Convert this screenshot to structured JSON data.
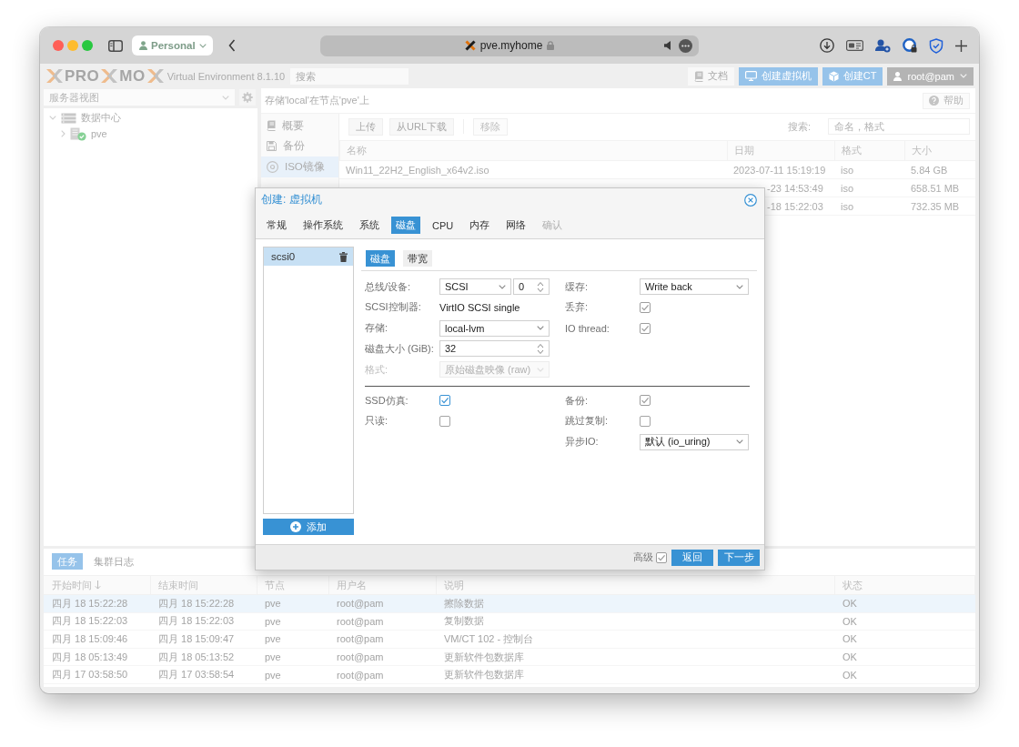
{
  "browser": {
    "profile": "Personal",
    "url": "pve.myhome"
  },
  "header": {
    "logo_parts": [
      "PRO",
      "MO"
    ],
    "product": "Virtual Environment 8.1.10",
    "search": {
      "placeholder": "搜索"
    },
    "buttons": [
      {
        "label": "文档",
        "kind": "docs"
      },
      {
        "label": "创建虚拟机",
        "kind": "vm"
      },
      {
        "label": "创建CT",
        "kind": "ct"
      }
    ],
    "user": "root@pam"
  },
  "sidebar": {
    "view": "服务器视图",
    "tree": [
      {
        "label": "数据中心",
        "kind": "datacenter",
        "expanded": true,
        "children": [
          {
            "label": "pve",
            "kind": "node",
            "expanded": false
          }
        ]
      }
    ]
  },
  "storage": {
    "title": "存储'local'在节点'pve'上",
    "help": "帮助",
    "nav": [
      {
        "label": "概要",
        "kind": "summary",
        "selected": false
      },
      {
        "label": "备份",
        "kind": "backup",
        "selected": false
      },
      {
        "label": "ISO镜像",
        "kind": "iso",
        "selected": true
      }
    ],
    "toolbar": [
      {
        "label": "上传",
        "disabled": false
      },
      {
        "label": "从URL下载",
        "disabled": false
      },
      {
        "label": "移除",
        "disabled": true
      }
    ],
    "search_label": "搜索:",
    "search": {
      "placeholder": "命名，格式"
    },
    "columns": [
      "名称",
      "日期",
      "格式",
      "大小"
    ],
    "rows": [
      {
        "name": "Win11_22H2_English_x64v2.iso",
        "date": "2023-07-11 15:19:19",
        "format": "iso",
        "size": "5.84 GB"
      },
      {
        "date": "-23 14:53:49",
        "format": "iso",
        "size": "658.51 MB"
      },
      {
        "date": "-18 15:22:03",
        "format": "iso",
        "size": "732.35 MB"
      }
    ]
  },
  "tasks": {
    "tabs": [
      {
        "label": "任务",
        "selected": true
      },
      {
        "label": "集群日志",
        "selected": false
      }
    ],
    "columns": [
      {
        "label": "开始时间",
        "sorted": true
      },
      {
        "label": "结束时间",
        "sorted": false
      },
      {
        "label": "节点",
        "sorted": false
      },
      {
        "label": "用户名",
        "sorted": false
      },
      {
        "label": "说明",
        "sorted": false
      },
      {
        "label": "状态",
        "sorted": false
      }
    ],
    "rows": [
      {
        "start": "四月 18 15:22:28",
        "end": "四月 18 15:22:28",
        "node": "pve",
        "user": "root@pam",
        "description": "擦除数据",
        "status": "OK",
        "selected": true
      },
      {
        "start": "四月 18 15:22:03",
        "end": "四月 18 15:22:03",
        "node": "pve",
        "user": "root@pam",
        "description": "复制数据",
        "status": "OK",
        "selected": false
      },
      {
        "start": "四月 18 15:09:46",
        "end": "四月 18 15:09:47",
        "node": "pve",
        "user": "root@pam",
        "description": "VM/CT 102 - 控制台",
        "status": "OK",
        "selected": false
      },
      {
        "start": "四月 18 05:13:49",
        "end": "四月 18 05:13:52",
        "node": "pve",
        "user": "root@pam",
        "description": "更新软件包数据库",
        "status": "OK",
        "selected": false
      },
      {
        "start": "四月 17 03:58:50",
        "end": "四月 17 03:58:54",
        "node": "pve",
        "user": "root@pam",
        "description": "更新软件包数据库",
        "status": "OK",
        "selected": false
      }
    ]
  },
  "dialog": {
    "title": "创建: 虚拟机",
    "tabs": [
      {
        "label": "常规",
        "selected": false,
        "disabled": false
      },
      {
        "label": "操作系统",
        "selected": false,
        "disabled": false
      },
      {
        "label": "系统",
        "selected": false,
        "disabled": false
      },
      {
        "label": "磁盘",
        "selected": true,
        "disabled": false
      },
      {
        "label": "CPU",
        "selected": false,
        "disabled": false
      },
      {
        "label": "内存",
        "selected": false,
        "disabled": false
      },
      {
        "label": "网络",
        "selected": false,
        "disabled": false
      },
      {
        "label": "确认",
        "selected": false,
        "disabled": true
      }
    ],
    "disks": [
      {
        "label": "scsi0",
        "selected": true
      }
    ],
    "add_button": "添加",
    "subtabs": [
      {
        "label": "磁盘",
        "selected": true
      },
      {
        "label": "带宽",
        "selected": false
      }
    ],
    "fields": {
      "left": [
        {
          "label": "总线/设备:",
          "kind": "combo_spin",
          "value": "SCSI",
          "number": "0",
          "disabled": false
        },
        {
          "label": "SCSI控制器:",
          "kind": "text",
          "value": "VirtIO SCSI single",
          "disabled": false
        },
        {
          "label": "存储:",
          "kind": "combo",
          "value": "local-lvm",
          "disabled": false
        },
        {
          "label": "磁盘大小 (GiB):",
          "kind": "spinner",
          "value": "32",
          "disabled": false
        },
        {
          "label": "格式:",
          "kind": "combo",
          "value": "原始磁盘映像 (raw)",
          "disabled": true
        }
      ],
      "right": [
        {
          "label": "缓存:",
          "kind": "combo",
          "value": "Write back",
          "disabled": false
        },
        {
          "label": "丢弃:",
          "kind": "checkbox",
          "checked": true,
          "focused": false,
          "disabled": false
        },
        {
          "label": "IO thread:",
          "kind": "checkbox",
          "checked": true,
          "focused": false,
          "disabled": false
        }
      ]
    },
    "advanced_fields": {
      "left": [
        {
          "label": "SSD仿真:",
          "kind": "checkbox",
          "checked": true,
          "focused": true,
          "disabled": false
        },
        {
          "label": "只读:",
          "kind": "checkbox",
          "checked": false,
          "focused": false,
          "disabled": false
        }
      ],
      "right": [
        {
          "label": "备份:",
          "kind": "checkbox",
          "checked": true,
          "focused": false,
          "disabled": false
        },
        {
          "label": "跳过复制:",
          "kind": "checkbox",
          "checked": false,
          "focused": false,
          "disabled": false
        },
        {
          "label": "异步IO:",
          "kind": "combo",
          "value": "默认 (io_uring)",
          "disabled": false
        }
      ]
    },
    "footer": {
      "advanced_label": "高级",
      "advanced_checked": true,
      "buttons": [
        "返回",
        "下一步"
      ]
    }
  }
}
